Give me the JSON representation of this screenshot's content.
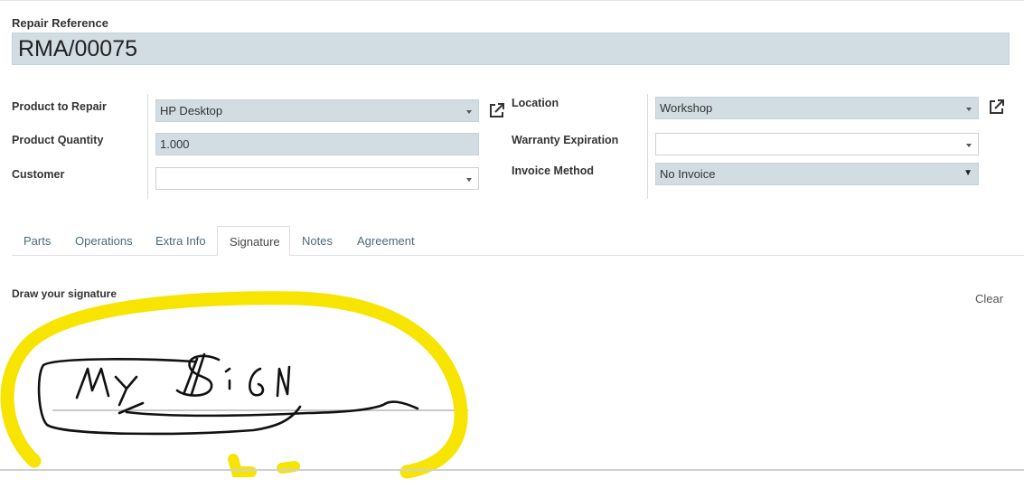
{
  "header": {
    "ref_label": "Repair Reference",
    "ref_value": "RMA/00075"
  },
  "form": {
    "product_label": "Product to Repair",
    "product_value": "HP Desktop",
    "quantity_label": "Product Quantity",
    "quantity_value": "1.000",
    "customer_label": "Customer",
    "customer_value": "",
    "location_label": "Location",
    "location_value": "Workshop",
    "warranty_label": "Warranty Expiration",
    "warranty_value": "",
    "invoice_label": "Invoice Method",
    "invoice_value": "No Invoice"
  },
  "tabs": [
    {
      "label": "Parts",
      "active": false
    },
    {
      "label": "Operations",
      "active": false
    },
    {
      "label": "Extra Info",
      "active": false
    },
    {
      "label": "Signature",
      "active": true
    },
    {
      "label": "Notes",
      "active": false
    },
    {
      "label": "Agreement",
      "active": false
    }
  ],
  "signature": {
    "label": "Draw your signature",
    "clear_label": "Clear",
    "drawn_text": "MY SIGN"
  },
  "colors": {
    "required_field_bg": "#d1dde3",
    "highlight_yellow": "#f7e400",
    "tab_text": "#4c6a7a"
  }
}
